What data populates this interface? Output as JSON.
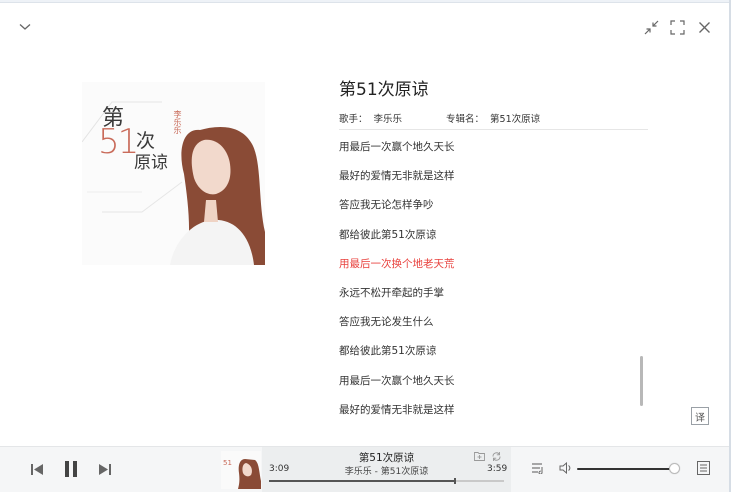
{
  "song": {
    "title": "第51次原谅",
    "artist_label": "歌手：",
    "artist": "李乐乐",
    "album_label": "专辑名：",
    "album": "第51次原谅"
  },
  "lyrics": [
    "用最后一次赢个地久天长",
    "最好的爱情无非就是这样",
    "答应我无论怎样争吵",
    "都给彼此第51次原谅",
    "用最后一次换个地老天荒",
    "永远不松开牵起的手掌",
    "答应我无论发生什么",
    "都给彼此第51次原谅",
    "用最后一次赢个地久天长",
    "最好的爱情无非就是这样"
  ],
  "active_lyric_index": 4,
  "translate_label": "译",
  "cover_art_text": {
    "big": "第",
    "num": "51",
    "small": "次",
    "name": "原谅",
    "artist": "李乐乐"
  },
  "player": {
    "title": "第51次原谅",
    "subtitle": "李乐乐 - 第51次原谅",
    "elapsed": "3:09",
    "duration": "3:59",
    "progress": 0.79,
    "volume": 0.95
  },
  "colors": {
    "active_lyric": "#e8413d",
    "player_bg": "#f5f6f7"
  },
  "icons": {
    "collapse": "chevron-down-icon",
    "minimize": "shrink-icon",
    "fullscreen": "fullscreen-icon",
    "close": "close-icon",
    "prev": "previous-icon",
    "pause": "pause-icon",
    "next": "next-icon",
    "playlist": "playlist-icon",
    "volume": "volume-icon",
    "lyrics": "lyrics-icon"
  }
}
